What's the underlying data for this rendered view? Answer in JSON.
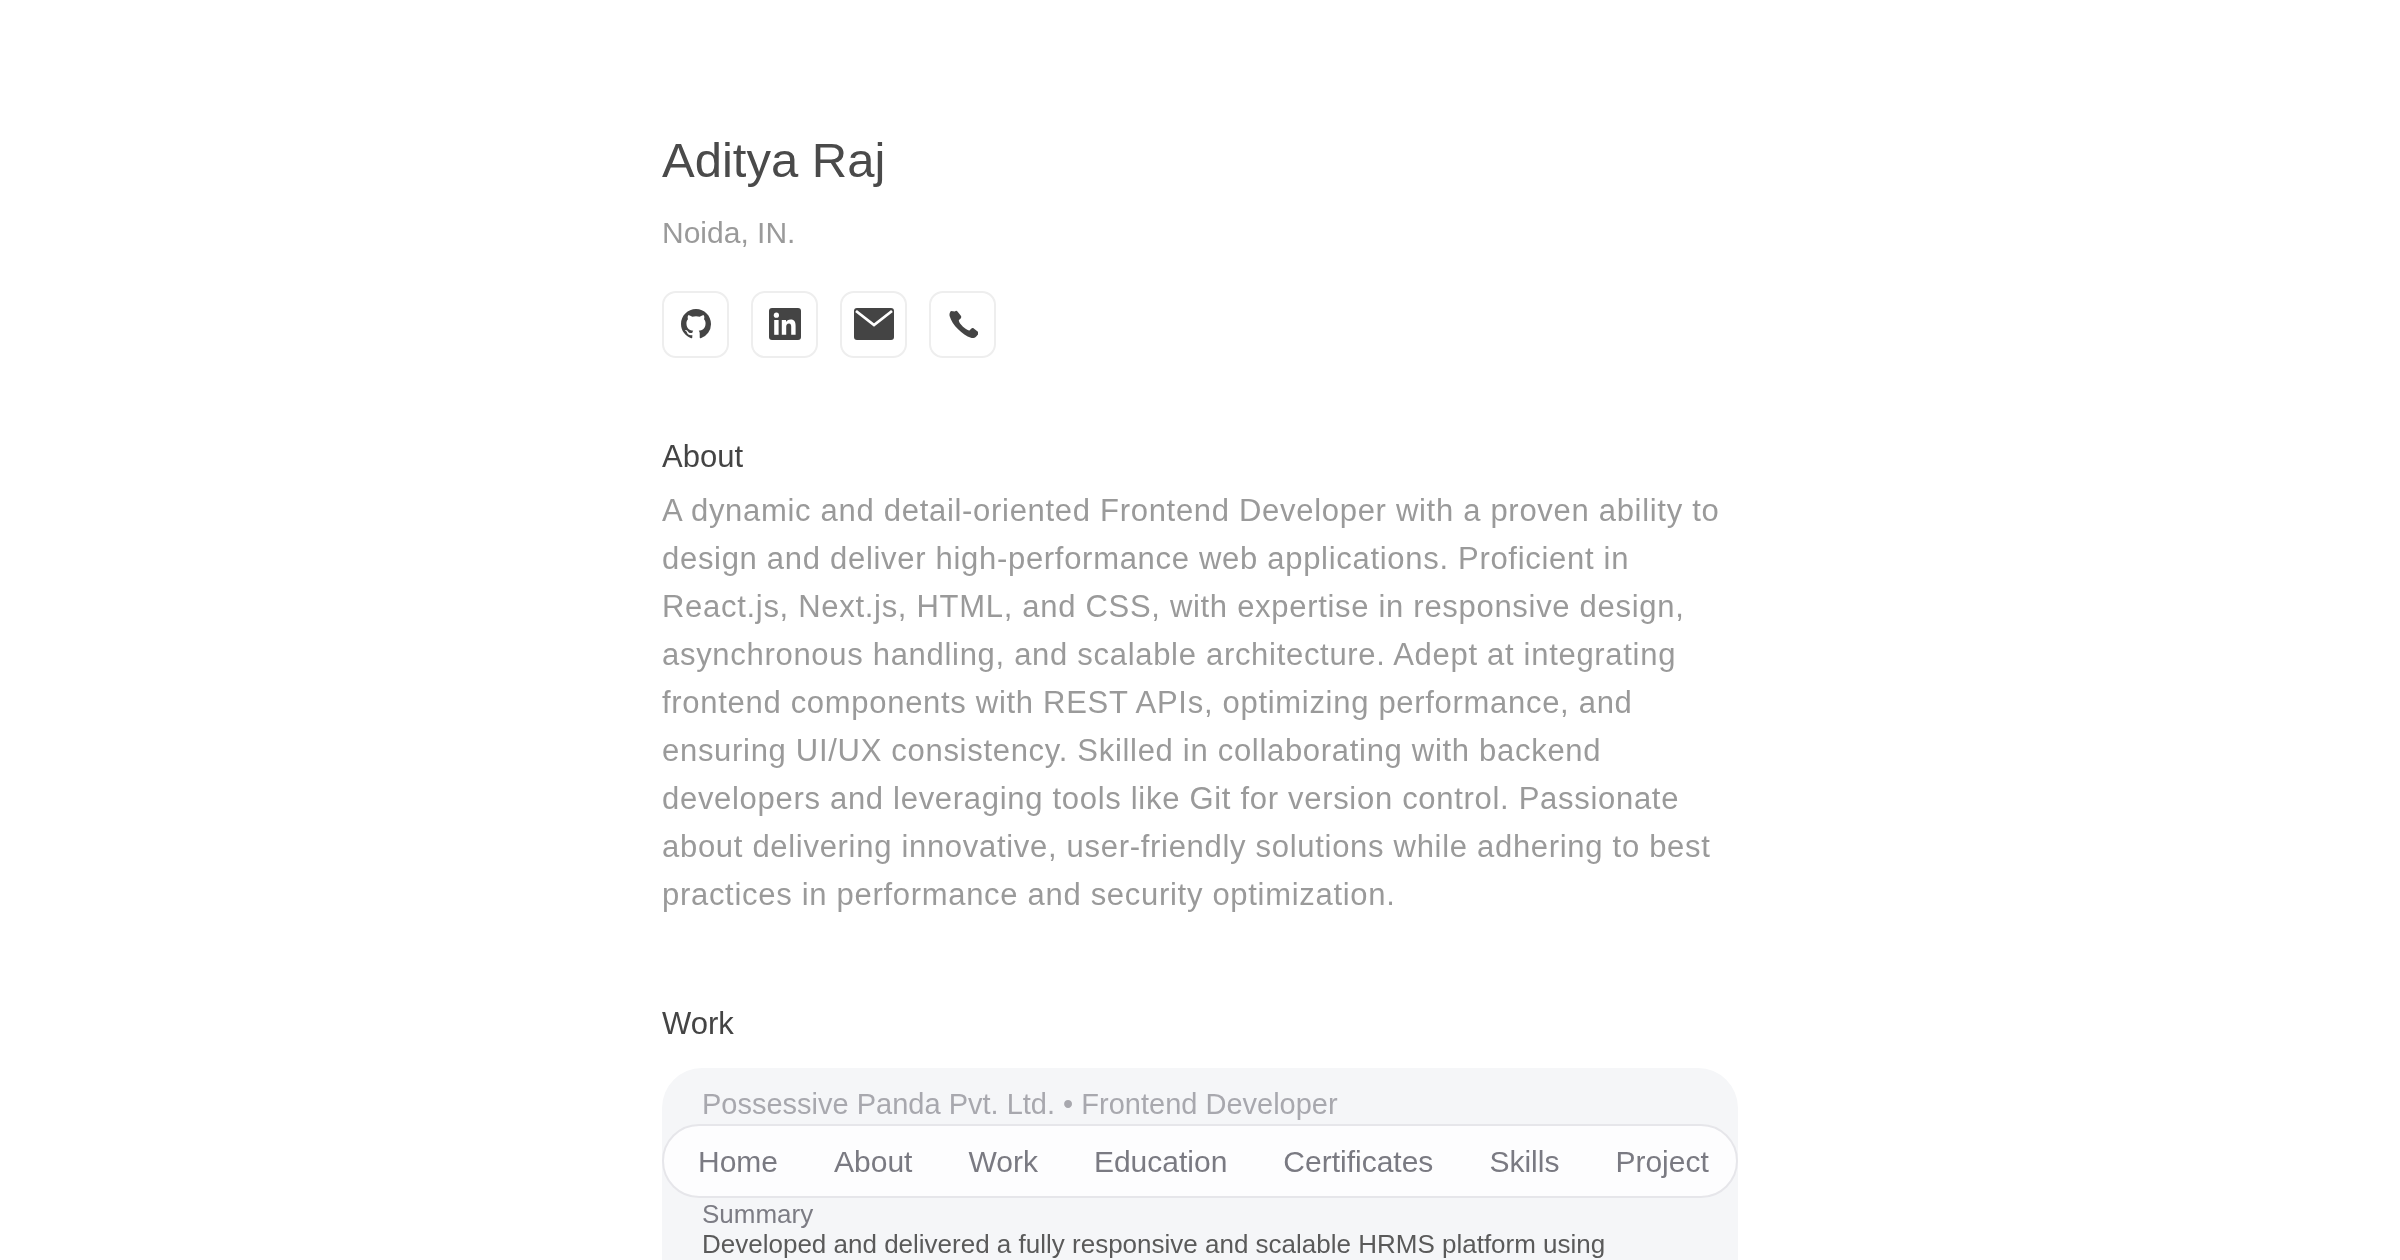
{
  "profile": {
    "name": "Aditya Raj",
    "location": "Noida, IN."
  },
  "social_links": [
    {
      "kind": "github"
    },
    {
      "kind": "linkedin"
    },
    {
      "kind": "email"
    },
    {
      "kind": "phone"
    }
  ],
  "about": {
    "heading": "About",
    "text": "A dynamic and detail-oriented Frontend Developer with a proven ability to design and deliver high-performance web applications. Proficient in React.js, Next.js, HTML, and CSS, with expertise in responsive design, asynchronous handling, and scalable architecture. Adept at integrating frontend components with REST APIs, optimizing performance, and ensuring UI/UX consistency. Skilled in collaborating with backend developers and leveraging tools like Git for version control. Passionate about delivering innovative, user-friendly solutions while adhering to best practices in performance and security optimization."
  },
  "work": {
    "heading": "Work",
    "entries": [
      {
        "company": "Possessive Panda Pvt. Ltd.",
        "separator": "•",
        "role": "Frontend Developer",
        "summary_label": "Summary",
        "description": "Developed and delivered a fully responsive and scalable HRMS platform using"
      }
    ]
  },
  "nav": {
    "items": [
      {
        "label": "Home"
      },
      {
        "label": "About"
      },
      {
        "label": "Work"
      },
      {
        "label": "Education"
      },
      {
        "label": "Certificates"
      },
      {
        "label": "Skills"
      },
      {
        "label": "Project"
      }
    ]
  }
}
